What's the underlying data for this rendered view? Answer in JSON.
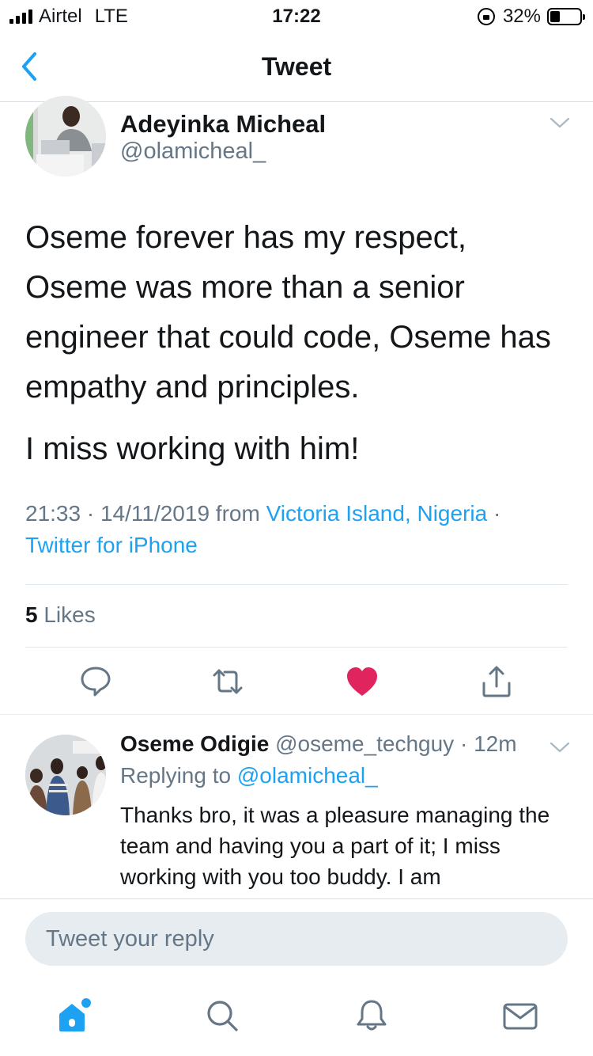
{
  "status_bar": {
    "carrier": "Airtel",
    "network": "LTE",
    "time": "17:22",
    "battery": "32%",
    "battery_level": 0.32
  },
  "nav": {
    "title": "Tweet"
  },
  "tweet": {
    "author_name": "Adeyinka Micheal",
    "author_handle": "@olamicheal_",
    "paragraphs": [
      "Oseme forever has my respect, Oseme was more than a senior engineer that could code, Oseme has empathy and principles.",
      "I miss working with him!"
    ],
    "timestamp": "21:33 · 14/11/2019 from",
    "location": "Victoria Island, Nigeria",
    "separator": "·",
    "source": "Twitter for iPhone",
    "likes_count": "5",
    "likes_label": "Likes"
  },
  "reply": {
    "author_name": "Oseme Odigie",
    "author_handle": "@oseme_techguy",
    "time": "· 12m",
    "replying_prefix": "Replying to",
    "replying_handle": "@olamicheal_",
    "text": "Thanks bro, it was a pleasure managing the team and having you a part of it; I miss working with you too buddy. I am"
  },
  "composer": {
    "placeholder": "Tweet your reply"
  },
  "colors": {
    "accent": "#1da1f2",
    "like": "#e0245e",
    "secondary_text": "#657786",
    "divider": "#e1e8ed"
  },
  "tab_icons": [
    "home-icon",
    "search-icon",
    "notifications-icon",
    "messages-icon"
  ]
}
